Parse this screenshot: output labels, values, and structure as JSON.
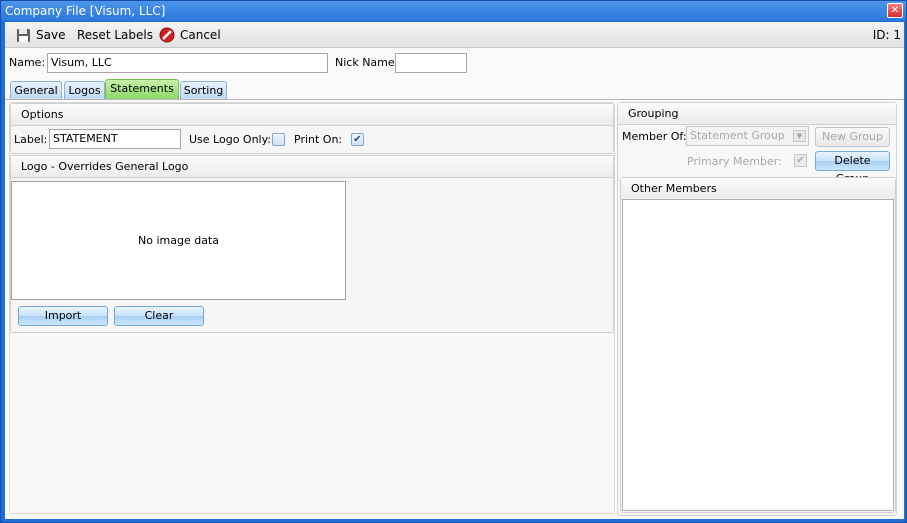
{
  "window": {
    "title": "Company File [Visum, LLC]",
    "close_icon": "close-icon"
  },
  "toolbar": {
    "save_label": "Save",
    "reset_labels_label": "Reset Labels",
    "cancel_label": "Cancel",
    "id_text": "ID: 1"
  },
  "header": {
    "name_label": "Name:",
    "name_value": "Visum, LLC",
    "nick_name_label": "Nick Name:",
    "nick_name_value": ""
  },
  "tabs": [
    {
      "label": "General",
      "active": false
    },
    {
      "label": "Logos",
      "active": false
    },
    {
      "label": "Statements",
      "active": true
    },
    {
      "label": "Sorting",
      "active": false
    }
  ],
  "options": {
    "title": "Options",
    "label_label": "Label:",
    "label_value": "STATEMENT",
    "use_logo_only_label": "Use Logo Only:",
    "use_logo_only_checked": false,
    "print_on_label": "Print On:",
    "print_on_checked": true
  },
  "logo": {
    "title": "Logo - Overrides General Logo",
    "placeholder": "No image data",
    "import_label": "Import",
    "clear_label": "Clear"
  },
  "grouping": {
    "title": "Grouping",
    "member_of_label": "Member Of:",
    "member_of_value": "Statement Group",
    "new_group_label": "New Group",
    "primary_member_label": "Primary Member:",
    "primary_member_checked": true,
    "delete_group_label": "Delete Group"
  },
  "other_members": {
    "title": "Other Members",
    "items": []
  }
}
